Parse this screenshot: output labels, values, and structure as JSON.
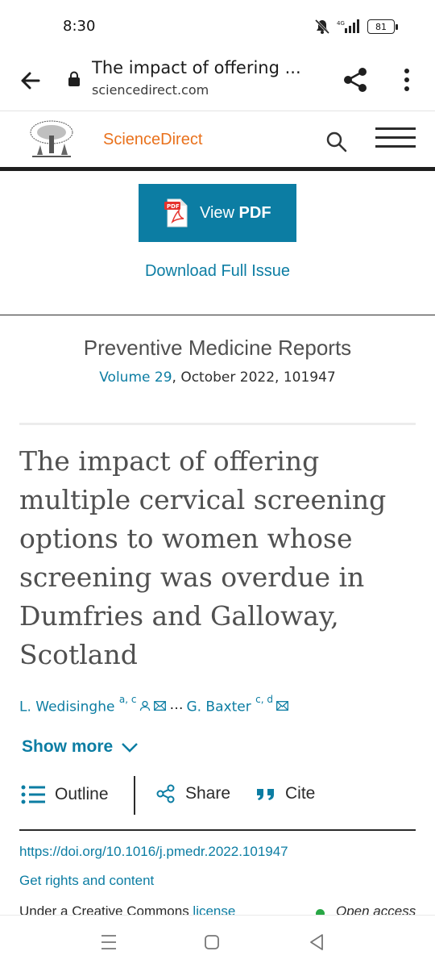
{
  "status": {
    "time": "8:30",
    "battery": "81"
  },
  "browser": {
    "title": "The impact of offering ...",
    "url": "sciencedirect.com"
  },
  "site": {
    "brand": "ScienceDirect"
  },
  "pdf_button": {
    "prefix": "View ",
    "bold": "PDF",
    "icon_text": "PDF"
  },
  "download_issue": "Download Full Issue",
  "journal": {
    "name": "Preventive Medicine Reports",
    "volume_link": "Volume 29",
    "volume_rest": ", October 2022, 101947"
  },
  "article": {
    "title": "The impact of offering multiple cervical screening options to women whose screening was overdue in Dumfries and Galloway, Scotland"
  },
  "authors": {
    "first_name": "L. Wedisinghe",
    "first_sup": "a, c",
    "ellipsis": "…",
    "last_name": "G. Baxter",
    "last_sup": "c, d"
  },
  "show_more": "Show more",
  "actions": {
    "outline": "Outline",
    "share": "Share",
    "cite": "Cite"
  },
  "doi": "https://doi.org/10.1016/j.pmedr.2022.101947",
  "rights": "Get rights and content",
  "license": {
    "text": "Under a Creative Commons ",
    "link": "license",
    "open_access": "Open access"
  },
  "colors": {
    "link": "#0c7da3",
    "brand": "#e9711c",
    "open_access_dot": "#28a745"
  },
  "icons": [
    "back-arrow-icon",
    "lock-icon",
    "share-icon",
    "more-vert-icon",
    "elsevier-tree-logo",
    "search-icon",
    "hamburger-icon",
    "pdf-file-icon",
    "user-icon",
    "mail-icon",
    "chevron-down-icon",
    "list-icon",
    "quote-icon",
    "mute-icon",
    "signal-icon"
  ]
}
